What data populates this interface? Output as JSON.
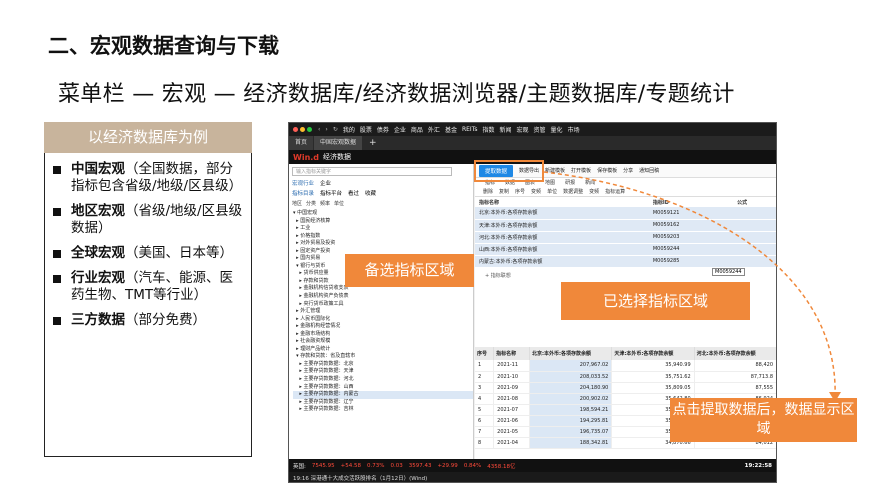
{
  "title": "二、宏观数据查询与下载",
  "subtitle": "菜单栏 — 宏观 — 经济数据库/经济数据浏览器/主题数据库/专题统计",
  "left_panel": {
    "header": "以经济数据库为例",
    "items": [
      {
        "bold": "中国宏观",
        "text": "（全国数据，部分指标包含省级/地级/区县级）"
      },
      {
        "bold": "地区宏观",
        "text": "（省级/地级/区县级数据）"
      },
      {
        "bold": "全球宏观",
        "text": "（美国、日本等）"
      },
      {
        "bold": "行业宏观",
        "text": "（汽车、能源、医药生物、TMT等行业）"
      },
      {
        "bold": "三方数据",
        "text": "（部分免费）"
      }
    ]
  },
  "app": {
    "menu": [
      "我的",
      "股票",
      "债券",
      "企业",
      "商品",
      "外汇",
      "基金",
      "REITs",
      "指数",
      "新闻",
      "宏观",
      "资管",
      "量化",
      "市场"
    ],
    "tabs": [
      "首页",
      "中国宏观数据"
    ],
    "add_tab": "+",
    "brand": "Win.d",
    "window_title": "经济数据",
    "search_placeholder": "输入指标关键字",
    "left_tabs": [
      "宏观行业",
      "企业"
    ],
    "left_subtabs": [
      "指标目录",
      "指标平台",
      "看过",
      "收藏"
    ],
    "filters": [
      "地区",
      "分类",
      "频率",
      "单位"
    ],
    "tree": [
      "▾ 中国宏观",
      "  ▸ 国民经济核算",
      "  ▸ 工业",
      "  ▸ 价格指数",
      "  ▸ 对外贸易及投资",
      "  ▸ 固定资产投资",
      "  ▸ 国内贸易",
      "  ▾ 银行与货币",
      "    ▸ 货币供应量",
      "    ▸ 存款和贷款",
      "    ▸ 金融机构信贷收支表",
      "    ▸ 金融机构资产负债表",
      "    ▸ 央行货币政策工具",
      "  ▸ 外汇管理",
      "  ▸ 人民币国际化",
      "  ▸ 金融机构经营情况",
      "  ▸ 金融市场结构",
      "  ▸ 社会融资规模",
      "  ▸ 理财产品统计",
      "  ▾ 存款和贷款：省及直辖市",
      "    ▸ 主要存贷款数据：北京",
      "    ▸ 主要存贷款数据：天津",
      "    ▸ 主要存贷款数据：河北",
      "    ▸ 主要存贷款数据：山西",
      "    ▸ 主要存贷款数据：内蒙古",
      "    ▸ 主要存贷款数据：辽宁",
      "    ▸ 主要存贷款数据：吉林"
    ],
    "toolbar": [
      "提取数据",
      "数据导出",
      "新建模板",
      "打开模板",
      "保存模板",
      "分享",
      "通知回稿"
    ],
    "subtabs": [
      "指标",
      "数据",
      "图表",
      "地图",
      "研报",
      "新闻"
    ],
    "toolbar2": [
      "删除",
      "复制",
      "序号",
      "变频",
      "单位",
      "数据调整",
      "变频",
      "指标运算"
    ],
    "selected_headers": [
      "指标名称",
      "指标ID",
      "公式"
    ],
    "selected_rows": [
      {
        "name": "北京:本外币:各项存款余额",
        "id": "M0059121"
      },
      {
        "name": "天津:本外币:各项存款余额",
        "id": "M0059162"
      },
      {
        "name": "河北:本外币:各项存款余额",
        "id": "M0059203"
      },
      {
        "name": "山西:本外币:各项存款余额",
        "id": "M0059244"
      },
      {
        "name": "内蒙古:本外币:各项存款余额",
        "id": "M0059285"
      }
    ],
    "tooltip_id": "M0059244",
    "add_indicator": "+ 指标联想",
    "data_headers": [
      "序号",
      "指标名称",
      "北京:本外币:各项存款余额",
      "天津:本外币:各项存款余额",
      "河北:本外币:各项存款余额"
    ],
    "data_rows": [
      {
        "idx": "1",
        "date": "2021-11",
        "bj": "207,967.02",
        "tj": "35,940.99",
        "hb": "88,420"
      },
      {
        "idx": "2",
        "date": "2021-10",
        "bj": "208,033.52",
        "tj": "35,751.62",
        "hb": "87,713.8"
      },
      {
        "idx": "3",
        "date": "2021-09",
        "bj": "204,180.90",
        "tj": "35,809.05",
        "hb": "87,555"
      },
      {
        "idx": "4",
        "date": "2021-08",
        "bj": "200,902.02",
        "tj": "35,642.80",
        "hb": "86,924"
      },
      {
        "idx": "5",
        "date": "2021-07",
        "bj": "198,594.21",
        "tj": "35,521.11",
        "hb": "86,300"
      },
      {
        "idx": "6",
        "date": "2021-06",
        "bj": "194,295.81",
        "tj": "35,480.92",
        "hb": "85,770"
      },
      {
        "idx": "7",
        "date": "2021-05",
        "bj": "196,735.07",
        "tj": "35,102.45",
        "hb": "84,850"
      },
      {
        "idx": "8",
        "date": "2021-04",
        "bj": "188,342.81",
        "tj": "34,870.66",
        "hb": "84,012"
      }
    ],
    "status": {
      "label": "英国:",
      "v1": "7545.95",
      "v2": "+54.58",
      "v3": "0.73%",
      "v4": "0.03",
      "v5": "3597.43",
      "v6": "+29.99",
      "v7": "0.84%",
      "v8": "4358.18亿",
      "time": "19:22:58"
    },
    "news": "19:16 深港通十大成交活跃股排名（1月12日）(Wind)"
  },
  "annotations": {
    "candidate": "备选指标区域",
    "selected": "已选择指标区域",
    "after_extract": "点击提取数据后，数据显示区域"
  }
}
